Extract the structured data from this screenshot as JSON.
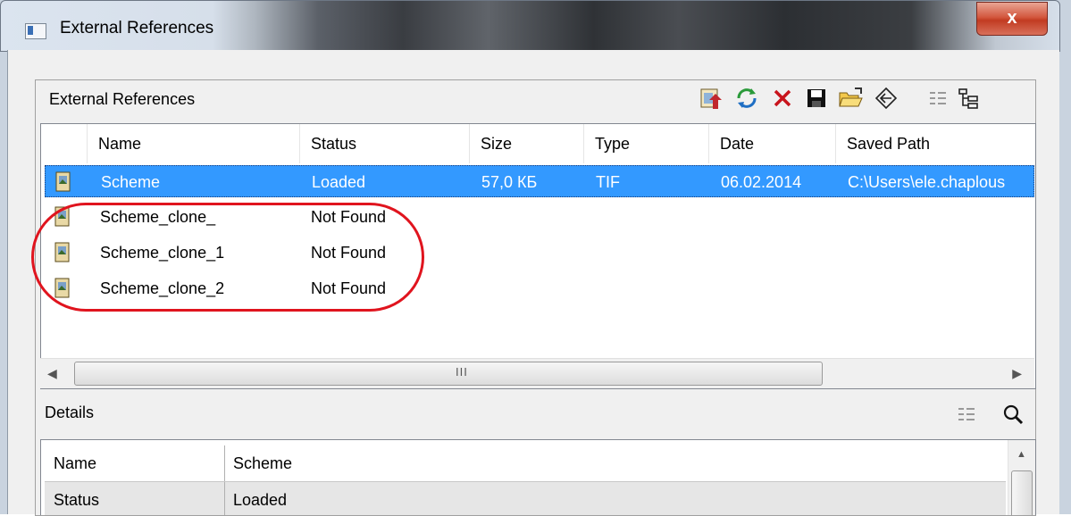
{
  "window": {
    "title": "External References",
    "close_label": "x"
  },
  "panel": {
    "title": "External References"
  },
  "toolbar": {
    "buttons": [
      "attach-image",
      "refresh",
      "detach",
      "save",
      "browse",
      "path",
      "list-view",
      "tree-view"
    ]
  },
  "columns": [
    "Name",
    "Status",
    "Size",
    "Type",
    "Date",
    "Saved Path"
  ],
  "rows": [
    {
      "name": "Scheme",
      "status": "Loaded",
      "size": "57,0 КБ",
      "type": "TIF",
      "date": "06.02.2014 ",
      "path": "C:\\Users\\ele.chaplous",
      "selected": true
    },
    {
      "name": "Scheme_clone_",
      "status": "Not Found",
      "size": "",
      "type": "",
      "date": "",
      "path": "",
      "selected": false
    },
    {
      "name": "Scheme_clone_1",
      "status": "Not Found",
      "size": "",
      "type": "",
      "date": "",
      "path": "",
      "selected": false
    },
    {
      "name": "Scheme_clone_2",
      "status": "Not Found",
      "size": "",
      "type": "",
      "date": "",
      "path": "",
      "selected": false
    }
  ],
  "scrollbar": {
    "grip": "III"
  },
  "details": {
    "title": "Details",
    "rows": [
      {
        "key": "Name",
        "value": "Scheme"
      },
      {
        "key": "Status",
        "value": "Loaded"
      }
    ]
  },
  "colors": {
    "selection": "#3399ff",
    "highlight_oval": "#e0141e",
    "close_button": "#c23b22"
  }
}
